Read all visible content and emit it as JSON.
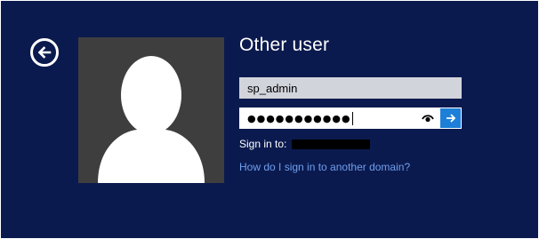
{
  "screen": {
    "title": "Other user",
    "colors": {
      "background": "#0b1a4e",
      "accent": "#1e7fd8",
      "link": "#6f9fee",
      "avatar_bg": "#3e3e3e"
    }
  },
  "icons": {
    "back": "back-arrow-icon",
    "avatar": "user-silhouette-icon",
    "reveal": "eye-icon",
    "submit": "arrow-right-icon"
  },
  "form": {
    "username_value": "sp_admin",
    "password_mask": "●●●●●●●●●●●",
    "signin_label": "Sign in to:"
  },
  "help_link": "How do I sign in to another domain?"
}
